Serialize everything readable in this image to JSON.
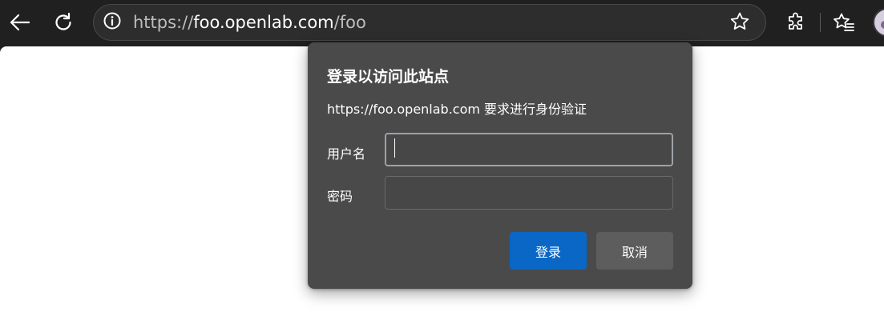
{
  "browser": {
    "url_scheme": "https://",
    "url_host": "foo.openlab.com",
    "url_path": "/foo",
    "icons": {
      "back": "back-arrow-icon",
      "refresh": "refresh-icon",
      "site_info": "info-icon",
      "favorite": "star-icon",
      "extensions": "puzzle-icon",
      "favorites_list": "favorites-icon",
      "profile": "avatar"
    }
  },
  "auth_dialog": {
    "title": "登录以访问此站点",
    "description": "https://foo.openlab.com 要求进行身份验证",
    "username_label": "用户名",
    "username_value": "",
    "password_label": "密码",
    "password_value": "",
    "sign_in_label": "登录",
    "cancel_label": "取消",
    "accent_color": "#0a67c5"
  }
}
